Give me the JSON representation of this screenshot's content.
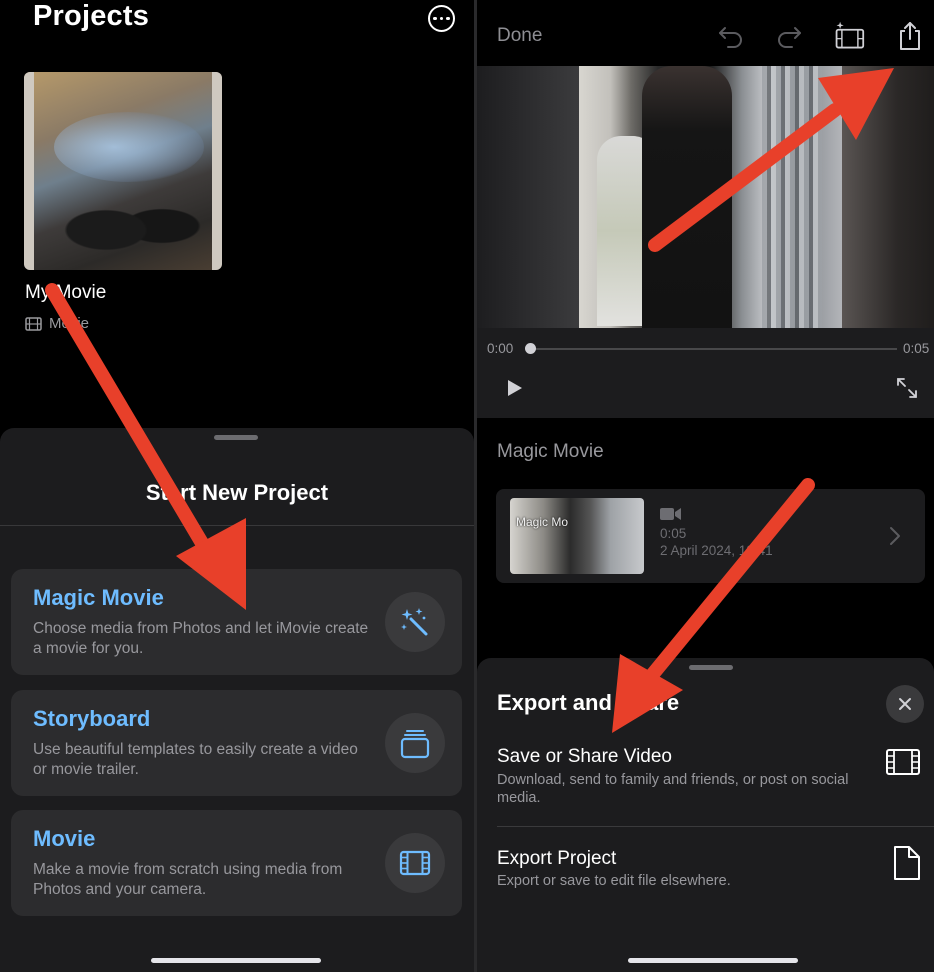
{
  "left": {
    "header": {
      "title": "Projects"
    },
    "project": {
      "name": "My Movie",
      "type": "Movie"
    },
    "sheet": {
      "title": "Start New Project",
      "options": [
        {
          "title": "Magic Movie",
          "description": "Choose media from Photos and let iMovie create a movie for you.",
          "icon": "magic-wand-icon"
        },
        {
          "title": "Storyboard",
          "description": "Use beautiful templates to easily create a video or movie trailer.",
          "icon": "stack-icon"
        },
        {
          "title": "Movie",
          "description": "Make a movie from scratch using media from Photos and your camera.",
          "icon": "film-icon"
        }
      ]
    }
  },
  "right": {
    "toolbar": {
      "done_label": "Done"
    },
    "player": {
      "current_time": "0:00",
      "duration": "0:05",
      "position": 0.0
    },
    "section_label": "Magic Movie",
    "clip": {
      "thumb_text": "Magic Mo",
      "duration": "0:05",
      "date": "2 April 2024, 12:41"
    },
    "export_sheet": {
      "title": "Export and Share",
      "rows": [
        {
          "title": "Save or Share Video",
          "description": "Download, send to family and friends, or post on social media.",
          "icon": "film-icon"
        },
        {
          "title": "Export Project",
          "description": "Export or save to edit file elsewhere.",
          "icon": "document-icon"
        }
      ]
    }
  },
  "colors": {
    "accent": "#6ebcff",
    "annotation_arrow": "#e8402a",
    "sheet": "#1c1c1e",
    "card": "#2c2c2e"
  }
}
